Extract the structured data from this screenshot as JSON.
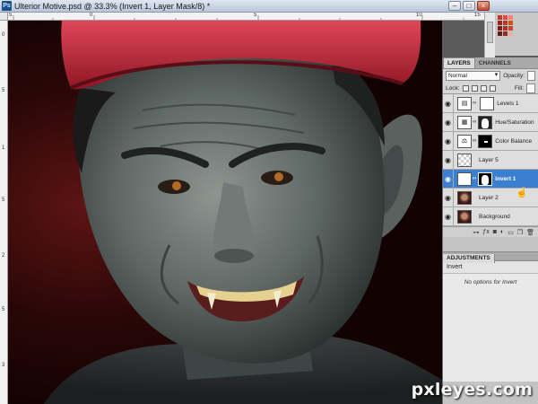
{
  "window": {
    "app_icon": "Ps",
    "title": "Ulterior Motive.psd @ 33.3% (Invert 1, Layer Mask/8) *",
    "controls": [
      "–",
      "□",
      "×"
    ]
  },
  "rulers": {
    "top": [
      "5",
      "0",
      "5",
      "10",
      "15"
    ],
    "left": [
      "0",
      "5",
      "1",
      "5",
      "2",
      "5",
      "3"
    ]
  },
  "layers_panel": {
    "tabs": [
      "LAYERS",
      "CHANNELS"
    ],
    "blend_mode": "Normal",
    "opacity_label": "Opacity:",
    "lock_label": "Lock:",
    "fill_label": "Fill:",
    "layers": [
      {
        "name": "Levels 1",
        "thumb": "levels-adjustment",
        "mask": "white",
        "selected": false
      },
      {
        "name": "Hue/Saturation",
        "thumb": "hue-sat-adjustment",
        "mask": "white",
        "selected": false
      },
      {
        "name": "Color Balance",
        "thumb": "color-balance-adjustment",
        "mask": "black",
        "selected": false
      },
      {
        "name": "Layer 5",
        "thumb": "transparent",
        "mask": "none",
        "selected": false
      },
      {
        "name": "Invert 1",
        "thumb": "invert-adjustment",
        "mask": "figure",
        "selected": true
      },
      {
        "name": "Layer 2",
        "thumb": "face",
        "mask": "none",
        "selected": false
      },
      {
        "name": "Background",
        "thumb": "face",
        "mask": "none",
        "selected": false
      }
    ],
    "footer_icons": [
      "link-icon",
      "fx-icon",
      "mask-icon",
      "adjustment-icon",
      "folder-icon",
      "new-layer-icon",
      "trash-icon"
    ]
  },
  "adjustments_panel": {
    "tab": "ADJUSTMENTS",
    "title": "Invert",
    "message": "No options for Invert"
  },
  "watermark": "pxleyes.com",
  "colors": {
    "selected_layer": "#3a7fd0",
    "panel_bg": "#c4c4c4",
    "cap_red": "#c8283a"
  }
}
